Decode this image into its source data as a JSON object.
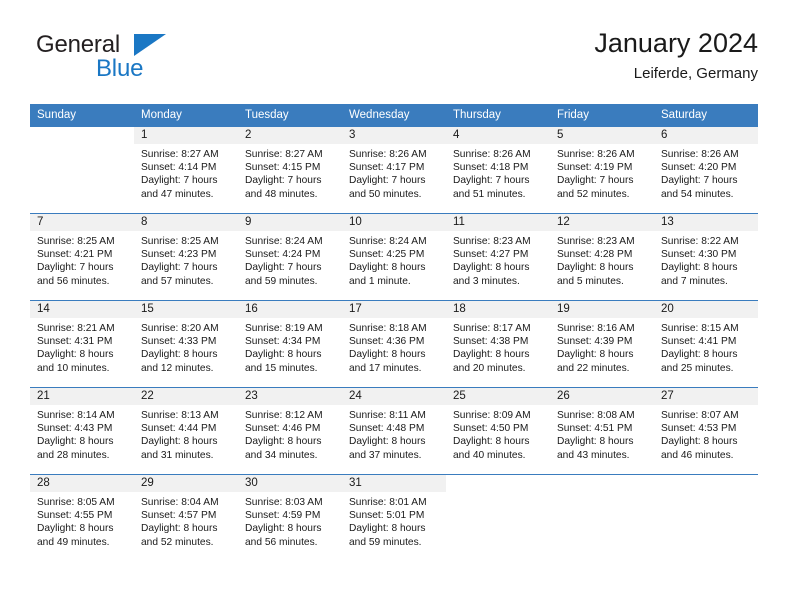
{
  "brand": {
    "name_line1": "General",
    "name_line2": "Blue",
    "primary_color": "#1a77c4"
  },
  "header": {
    "title": "January 2024",
    "subtitle": "Leiferde, Germany"
  },
  "calendar": {
    "header_color": "#3a7cbe",
    "weekday_headers": [
      "Sunday",
      "Monday",
      "Tuesday",
      "Wednesday",
      "Thursday",
      "Friday",
      "Saturday"
    ],
    "weeks": [
      [
        {
          "day": "",
          "sunrise": "",
          "sunset": "",
          "daylight_1": "",
          "daylight_2": ""
        },
        {
          "day": "1",
          "sunrise": "Sunrise: 8:27 AM",
          "sunset": "Sunset: 4:14 PM",
          "daylight_1": "Daylight: 7 hours",
          "daylight_2": "and 47 minutes."
        },
        {
          "day": "2",
          "sunrise": "Sunrise: 8:27 AM",
          "sunset": "Sunset: 4:15 PM",
          "daylight_1": "Daylight: 7 hours",
          "daylight_2": "and 48 minutes."
        },
        {
          "day": "3",
          "sunrise": "Sunrise: 8:26 AM",
          "sunset": "Sunset: 4:17 PM",
          "daylight_1": "Daylight: 7 hours",
          "daylight_2": "and 50 minutes."
        },
        {
          "day": "4",
          "sunrise": "Sunrise: 8:26 AM",
          "sunset": "Sunset: 4:18 PM",
          "daylight_1": "Daylight: 7 hours",
          "daylight_2": "and 51 minutes."
        },
        {
          "day": "5",
          "sunrise": "Sunrise: 8:26 AM",
          "sunset": "Sunset: 4:19 PM",
          "daylight_1": "Daylight: 7 hours",
          "daylight_2": "and 52 minutes."
        },
        {
          "day": "6",
          "sunrise": "Sunrise: 8:26 AM",
          "sunset": "Sunset: 4:20 PM",
          "daylight_1": "Daylight: 7 hours",
          "daylight_2": "and 54 minutes."
        }
      ],
      [
        {
          "day": "7",
          "sunrise": "Sunrise: 8:25 AM",
          "sunset": "Sunset: 4:21 PM",
          "daylight_1": "Daylight: 7 hours",
          "daylight_2": "and 56 minutes."
        },
        {
          "day": "8",
          "sunrise": "Sunrise: 8:25 AM",
          "sunset": "Sunset: 4:23 PM",
          "daylight_1": "Daylight: 7 hours",
          "daylight_2": "and 57 minutes."
        },
        {
          "day": "9",
          "sunrise": "Sunrise: 8:24 AM",
          "sunset": "Sunset: 4:24 PM",
          "daylight_1": "Daylight: 7 hours",
          "daylight_2": "and 59 minutes."
        },
        {
          "day": "10",
          "sunrise": "Sunrise: 8:24 AM",
          "sunset": "Sunset: 4:25 PM",
          "daylight_1": "Daylight: 8 hours",
          "daylight_2": "and 1 minute."
        },
        {
          "day": "11",
          "sunrise": "Sunrise: 8:23 AM",
          "sunset": "Sunset: 4:27 PM",
          "daylight_1": "Daylight: 8 hours",
          "daylight_2": "and 3 minutes."
        },
        {
          "day": "12",
          "sunrise": "Sunrise: 8:23 AM",
          "sunset": "Sunset: 4:28 PM",
          "daylight_1": "Daylight: 8 hours",
          "daylight_2": "and 5 minutes."
        },
        {
          "day": "13",
          "sunrise": "Sunrise: 8:22 AM",
          "sunset": "Sunset: 4:30 PM",
          "daylight_1": "Daylight: 8 hours",
          "daylight_2": "and 7 minutes."
        }
      ],
      [
        {
          "day": "14",
          "sunrise": "Sunrise: 8:21 AM",
          "sunset": "Sunset: 4:31 PM",
          "daylight_1": "Daylight: 8 hours",
          "daylight_2": "and 10 minutes."
        },
        {
          "day": "15",
          "sunrise": "Sunrise: 8:20 AM",
          "sunset": "Sunset: 4:33 PM",
          "daylight_1": "Daylight: 8 hours",
          "daylight_2": "and 12 minutes."
        },
        {
          "day": "16",
          "sunrise": "Sunrise: 8:19 AM",
          "sunset": "Sunset: 4:34 PM",
          "daylight_1": "Daylight: 8 hours",
          "daylight_2": "and 15 minutes."
        },
        {
          "day": "17",
          "sunrise": "Sunrise: 8:18 AM",
          "sunset": "Sunset: 4:36 PM",
          "daylight_1": "Daylight: 8 hours",
          "daylight_2": "and 17 minutes."
        },
        {
          "day": "18",
          "sunrise": "Sunrise: 8:17 AM",
          "sunset": "Sunset: 4:38 PM",
          "daylight_1": "Daylight: 8 hours",
          "daylight_2": "and 20 minutes."
        },
        {
          "day": "19",
          "sunrise": "Sunrise: 8:16 AM",
          "sunset": "Sunset: 4:39 PM",
          "daylight_1": "Daylight: 8 hours",
          "daylight_2": "and 22 minutes."
        },
        {
          "day": "20",
          "sunrise": "Sunrise: 8:15 AM",
          "sunset": "Sunset: 4:41 PM",
          "daylight_1": "Daylight: 8 hours",
          "daylight_2": "and 25 minutes."
        }
      ],
      [
        {
          "day": "21",
          "sunrise": "Sunrise: 8:14 AM",
          "sunset": "Sunset: 4:43 PM",
          "daylight_1": "Daylight: 8 hours",
          "daylight_2": "and 28 minutes."
        },
        {
          "day": "22",
          "sunrise": "Sunrise: 8:13 AM",
          "sunset": "Sunset: 4:44 PM",
          "daylight_1": "Daylight: 8 hours",
          "daylight_2": "and 31 minutes."
        },
        {
          "day": "23",
          "sunrise": "Sunrise: 8:12 AM",
          "sunset": "Sunset: 4:46 PM",
          "daylight_1": "Daylight: 8 hours",
          "daylight_2": "and 34 minutes."
        },
        {
          "day": "24",
          "sunrise": "Sunrise: 8:11 AM",
          "sunset": "Sunset: 4:48 PM",
          "daylight_1": "Daylight: 8 hours",
          "daylight_2": "and 37 minutes."
        },
        {
          "day": "25",
          "sunrise": "Sunrise: 8:09 AM",
          "sunset": "Sunset: 4:50 PM",
          "daylight_1": "Daylight: 8 hours",
          "daylight_2": "and 40 minutes."
        },
        {
          "day": "26",
          "sunrise": "Sunrise: 8:08 AM",
          "sunset": "Sunset: 4:51 PM",
          "daylight_1": "Daylight: 8 hours",
          "daylight_2": "and 43 minutes."
        },
        {
          "day": "27",
          "sunrise": "Sunrise: 8:07 AM",
          "sunset": "Sunset: 4:53 PM",
          "daylight_1": "Daylight: 8 hours",
          "daylight_2": "and 46 minutes."
        }
      ],
      [
        {
          "day": "28",
          "sunrise": "Sunrise: 8:05 AM",
          "sunset": "Sunset: 4:55 PM",
          "daylight_1": "Daylight: 8 hours",
          "daylight_2": "and 49 minutes."
        },
        {
          "day": "29",
          "sunrise": "Sunrise: 8:04 AM",
          "sunset": "Sunset: 4:57 PM",
          "daylight_1": "Daylight: 8 hours",
          "daylight_2": "and 52 minutes."
        },
        {
          "day": "30",
          "sunrise": "Sunrise: 8:03 AM",
          "sunset": "Sunset: 4:59 PM",
          "daylight_1": "Daylight: 8 hours",
          "daylight_2": "and 56 minutes."
        },
        {
          "day": "31",
          "sunrise": "Sunrise: 8:01 AM",
          "sunset": "Sunset: 5:01 PM",
          "daylight_1": "Daylight: 8 hours",
          "daylight_2": "and 59 minutes."
        },
        {
          "day": "",
          "sunrise": "",
          "sunset": "",
          "daylight_1": "",
          "daylight_2": ""
        },
        {
          "day": "",
          "sunrise": "",
          "sunset": "",
          "daylight_1": "",
          "daylight_2": ""
        },
        {
          "day": "",
          "sunrise": "",
          "sunset": "",
          "daylight_1": "",
          "daylight_2": ""
        }
      ]
    ]
  }
}
